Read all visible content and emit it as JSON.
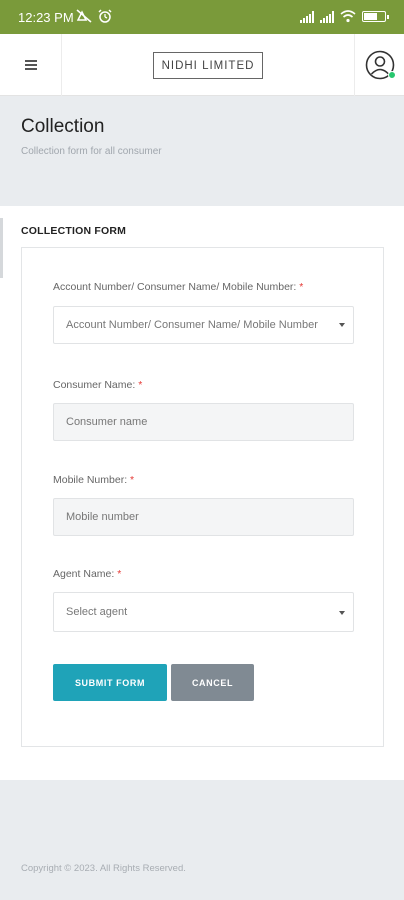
{
  "status_bar": {
    "time": "12:23 PM",
    "battery_level": 0.7,
    "colors": {
      "background": "#7a9a3a"
    }
  },
  "header": {
    "logo_text": "NIDHI LIMITED",
    "menu_icon": "hamburger-icon",
    "profile_icon": "user-circle-icon",
    "online_status_color": "#28c76f"
  },
  "page": {
    "title": "Collection",
    "subtitle": "Collection form for all consumer"
  },
  "form": {
    "section_title": "COLLECTION FORM",
    "fields": [
      {
        "label": "Account Number/ Consumer Name/ Mobile Number:",
        "required_mark": "*",
        "placeholder": "Account Number/ Consumer Name/ Mobile Number",
        "type": "select"
      },
      {
        "label": "Consumer Name:",
        "required_mark": "*",
        "placeholder": "Consumer name",
        "type": "text"
      },
      {
        "label": "Mobile Number:",
        "required_mark": "*",
        "placeholder": "Mobile number",
        "type": "text"
      },
      {
        "label": "Agent Name:",
        "required_mark": "*",
        "placeholder": "Select agent",
        "type": "select"
      }
    ],
    "submit_label": "SUBMIT FORM",
    "cancel_label": "CANCEL",
    "colors": {
      "submit": "#1fa3b8",
      "cancel": "#808a93",
      "required": "#e53935"
    }
  },
  "footer": {
    "copyright": "Copyright © 2023. All Rights Reserved."
  }
}
